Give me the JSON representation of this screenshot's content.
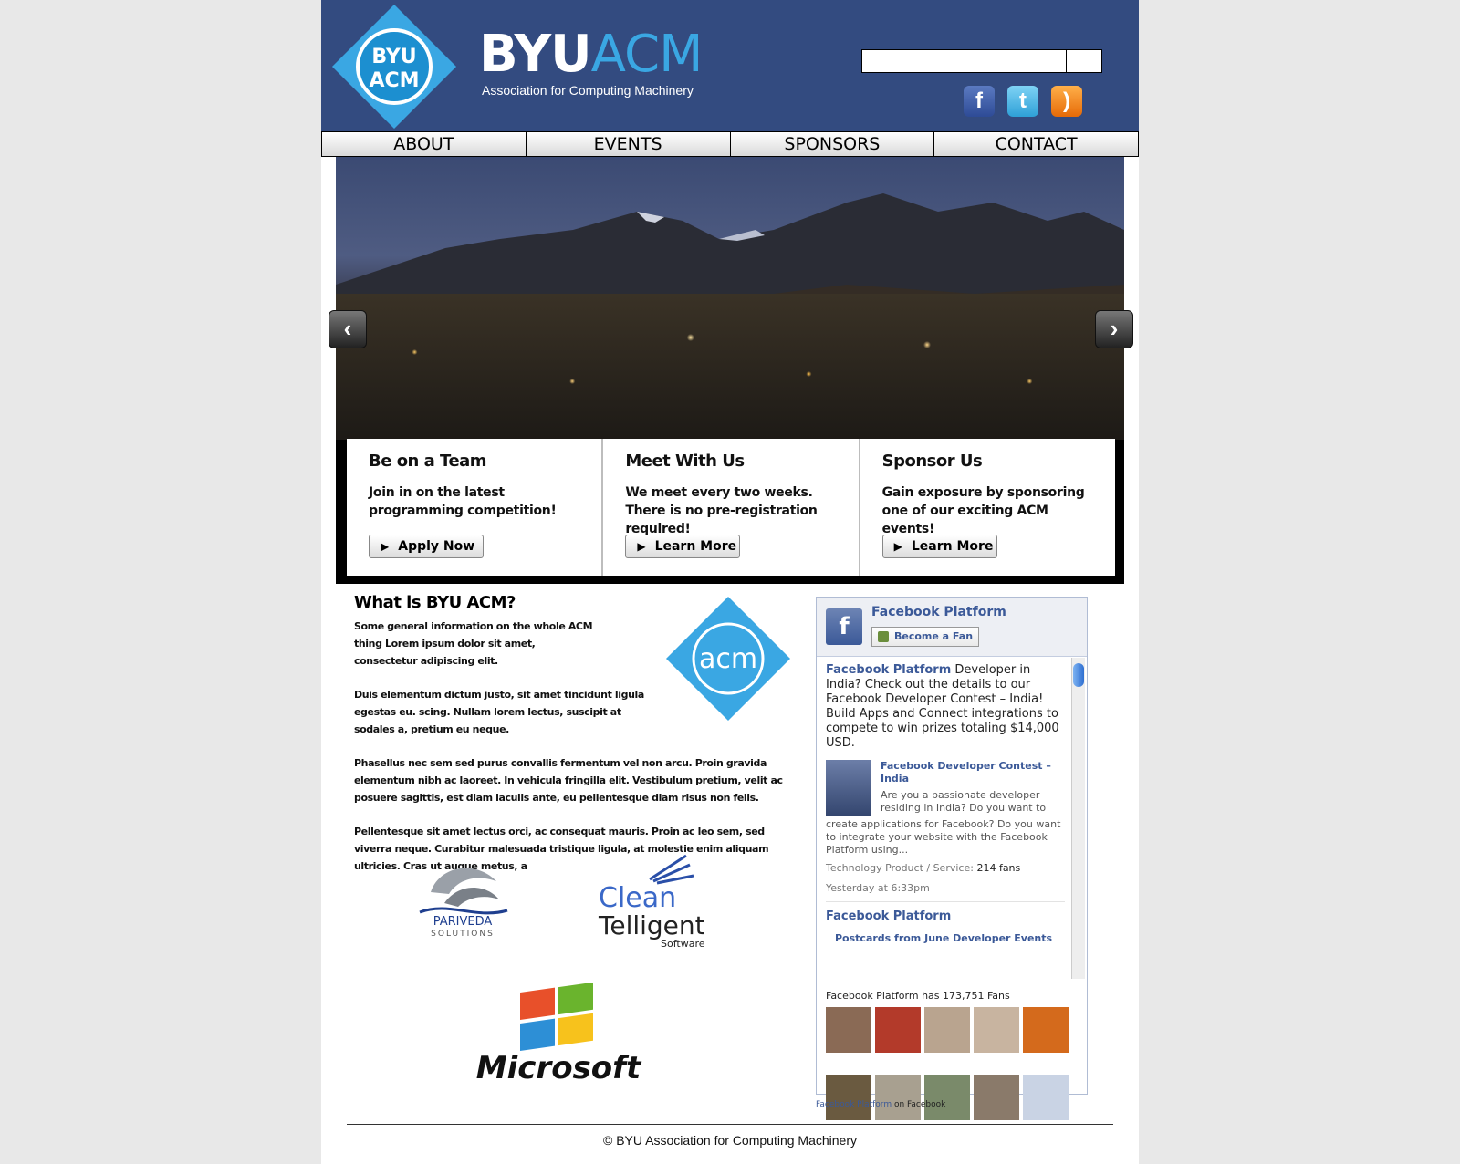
{
  "header": {
    "logo_text_top": "BYU",
    "logo_text_bottom": "ACM",
    "brand_part1": "BYU",
    "brand_part2": "ACM",
    "tagline": "Association for Computing Machinery",
    "search_value": "",
    "social": [
      {
        "icon": "facebook-icon",
        "glyph": "f"
      },
      {
        "icon": "twitter-icon",
        "glyph": "t"
      },
      {
        "icon": "rss-icon",
        "glyph": ")"
      }
    ]
  },
  "nav": [
    "ABOUT",
    "EVENTS",
    "SPONSORS",
    "CONTACT"
  ],
  "hero": {
    "prev_icon": "chevron-left-icon",
    "next_icon": "chevron-right-icon",
    "cards": [
      {
        "title": "Be on a Team",
        "text": "Join in on the latest programming competition!",
        "button": "Apply Now"
      },
      {
        "title": "Meet With Us",
        "text": "We meet every two weeks. There is no pre-registration required!",
        "button": "Learn More"
      },
      {
        "title": "Sponsor Us",
        "text": "Gain exposure by sponsoring one of our exciting ACM events!",
        "button": "Learn More"
      }
    ]
  },
  "about": {
    "heading": "What is BYU ACM?",
    "p1": "Some general information on the whole ACM thing Lorem ipsum dolor sit amet, consectetur adipiscing elit.",
    "p2": "Duis elementum dictum justo, sit amet tincidunt ligula egestas eu. scing. Nullam lorem lectus, suscipit at sodales a, pretium eu neque.",
    "p3": "Phasellus nec sem sed purus convallis fermentum vel non arcu. Proin gravida elementum nibh ac laoreet. In vehicula fringilla elit. Vestibulum pretium, velit ac posuere sagittis, est diam iaculis ante, eu pellentesque diam risus non felis.",
    "p4": "Pellentesque sit amet lectus orci, ac consequat mauris. Proin ac leo sem, sed viverra neque. Curabitur malesuada tristique ligula, at molestie enim aliquam ultricies. Cras ut augue metus, a",
    "acm_logo_text": "acm"
  },
  "sponsors": {
    "pariveda_name": "PARIVEDA",
    "pariveda_sub": "SOLUTIONS",
    "clean_line1": "Clean",
    "clean_line2": "Telligent",
    "clean_line3": "Software",
    "microsoft": "Microsoft"
  },
  "facebook": {
    "page_name": "Facebook Platform",
    "fan_button": "Become a Fan",
    "post_author": "Facebook Platform",
    "post_text": " Developer in India? Check out the details to our Facebook Developer Contest – India! Build Apps and Connect integrations to compete to win prizes totaling $14,000 USD.",
    "attachment_title": "Facebook Developer Contest – India",
    "attachment_desc_short": "Are you a passionate developer residing in India? Do you want to",
    "attachment_desc_rest": "create applications for Facebook? Do you want to integrate your website with the Facebook Platform using...",
    "meta_label": "Technology Product / Service:",
    "meta_value": "214 fans",
    "time": "Yesterday at 6:33pm",
    "post2_author": "Facebook Platform",
    "post2_sub": "Postcards from June Developer Events",
    "fans_line": "Facebook Platform has 173,751 Fans",
    "fan_colors": [
      "#8a6a55",
      "#b33a2a",
      "#b9a48f",
      "#c8b4a0",
      "#d46a1c",
      "#6a5a40",
      "#a8a090",
      "#7a8a6a",
      "#8a7a6a",
      "#c9d3e4"
    ],
    "footer_link": "Facebook Platform",
    "footer_suffix": " on Facebook"
  },
  "footer": "© BYU Association for Computing Machinery"
}
